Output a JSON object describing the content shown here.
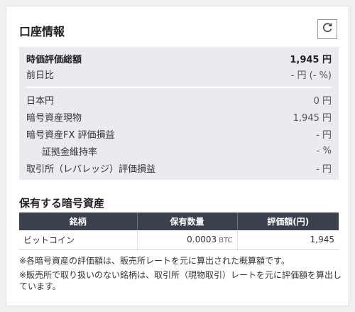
{
  "header": {
    "title": "口座情報"
  },
  "icons": {
    "refresh": "refresh-icon"
  },
  "summary": {
    "total_label": "時価評価総額",
    "total_value": "1,945 円",
    "prev_label": "前日比",
    "prev_value": "- 円 (- %)",
    "jpy_label": "日本円",
    "jpy_value": "0 円",
    "spot_label": "暗号資産現物",
    "spot_value": "1,945 円",
    "fx_label": "暗号資産FX 評価損益",
    "fx_value": "- 円",
    "margin_label": "証拠金維持率",
    "margin_value": "- %",
    "lev_label": "取引所（レバレッジ）評価損益",
    "lev_value": "- 円"
  },
  "holdings": {
    "title": "保有する暗号資産",
    "columns": [
      "銘柄",
      "保有数量",
      "評価額(円)"
    ],
    "rows": [
      {
        "name": "ビットコイン",
        "qty": "0.0003",
        "unit": "BTC",
        "value": "1,945"
      }
    ]
  },
  "notes": {
    "n1": "※各暗号資産の評価額は、販売所レートを元に算出された概算額です。",
    "n2": "※販売所で取り扱いのない銘柄は、取引所（現物取引）レートを元に評価額を算出しています。"
  }
}
